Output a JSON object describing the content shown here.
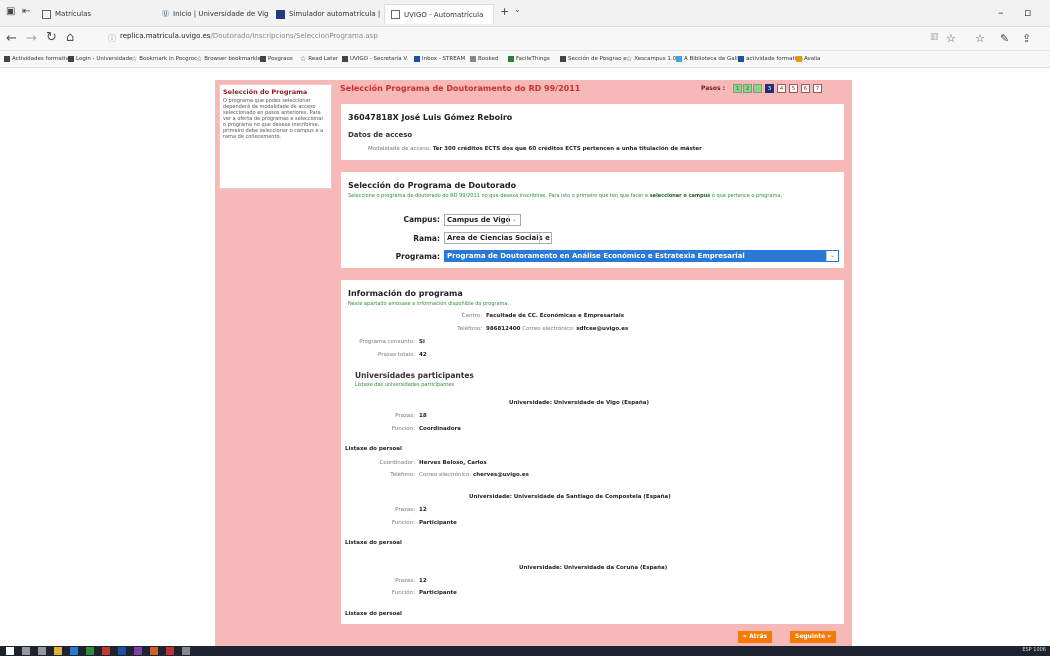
{
  "browser": {
    "tabs": [
      {
        "label": "Matrículas",
        "active": false
      },
      {
        "label": "Inicio | Universidade de Vig",
        "active": false
      },
      {
        "label": "Simulador automatrícula | S",
        "active": false
      },
      {
        "label": "UVIGO - Automatrícula",
        "active": true
      }
    ],
    "url_host": "replica.matricula.uvigo.es",
    "url_path": "/Doutorado/Inscripcions/SeleccionPrograma.asp",
    "favorites": [
      "Actividades formativ",
      "Login - Universidade",
      "Bookmark in Pocgroc",
      "Browser bookmarklet",
      "Posgraos",
      "Read Later",
      "UVIGO - Secretaría V.",
      "Inbox - STREAM",
      "Booked",
      "FacileThings",
      "Sección de Posgrao e",
      "Xescampus 1.0",
      "A Biblioteca de Galic",
      "actividade formativa",
      "Avalia"
    ]
  },
  "sidebar": {
    "title": "Selección do Programa",
    "text": "O programa que podes seleccionar dependerá da modalidade de acceso seleccionado en pasos anteriores. Para ver a oferta de programas e seleccionar o programa no que desexa inscribirse, primeiro debe seleccionar o campus e a rama de coñecemento."
  },
  "header": {
    "title": "Selección Programa de Doutoramento do RD 99/2011",
    "pasos_label": "Pasos :",
    "steps": [
      "1",
      "2",
      "3",
      "4",
      "5",
      "6",
      "7"
    ]
  },
  "person": {
    "name": "36047818X José Luis Gómez Reboiro",
    "access_heading": "Datos de acceso",
    "modalidade_label": "Modalidade de acceso:",
    "modalidade_value": "Ter 300 créditos ECTS dos que 60 créditos ECTS pertencen a unha titulación de máster"
  },
  "selection": {
    "heading": "Selección do Programa de Doutorado",
    "help_pre": "Seleccione o programa de doutorado do RD 99/2011 no que desexa inscribirse. Para isto o primeiro que ten que facer é",
    "help_bold": "seleccionar o campus",
    "help_post": "ó que pertence o programa.",
    "campus_label": "Campus:",
    "campus_value": "Campus de Vigo",
    "rama_label": "Rama:",
    "rama_value": "Area de Ciencias Sociais e Xurídicas",
    "programa_label": "Programa:",
    "programa_value": "Programa de Doutoramento en Análise Económico e Estratexia Empresarial"
  },
  "info": {
    "heading": "Información do programa",
    "subtitle": "Neste apartado amosase a información dispoñible do programa.",
    "centro_label": "Centro:",
    "centro_value": "Facultade de CC. Económicas e Empresariais",
    "telefono_label": "Teléfono:",
    "telefono_value": "986812400",
    "correo_label": "Correo electrónico:",
    "correo_value": "sdfcee@uvigo.es",
    "conxunto_label": "Programa conxunto:",
    "conxunto_value": "Si",
    "prazas_totais_label": "Prazas totais:",
    "prazas_totais_value": "42",
    "univ_heading": "Universidades participantes",
    "univ_subtitle": "Listaxe das universidades participantes",
    "universities": [
      {
        "label": "Universidade:",
        "name": "Universidade de Vigo (España)",
        "prazas": "18",
        "funcion": "Coordinadora"
      },
      {
        "label": "Universidade:",
        "name": "Universidade de Santiago de Compostela (España)",
        "prazas": "12",
        "funcion": "Participante"
      },
      {
        "label": "Universidade:",
        "name": "Universidade da Coruña (España)",
        "prazas": "12",
        "funcion": "Participante"
      }
    ],
    "prazas_label": "Prazas:",
    "funcion_label": "Función:",
    "listaxe_persoal": "Listaxe do persoal",
    "coordinador_label": "Coordinador:",
    "coordinador_value": "Herves Beloso, Carlos",
    "coord_tel_label": "Teléfono:",
    "coord_mail_label": "Correo electrónico:",
    "coord_mail_value": "cherves@uvigo.es"
  },
  "buttons": {
    "back": "« Atrás",
    "next": "Seguinte »"
  },
  "taskbar": {
    "tray": "ESP 1006"
  }
}
